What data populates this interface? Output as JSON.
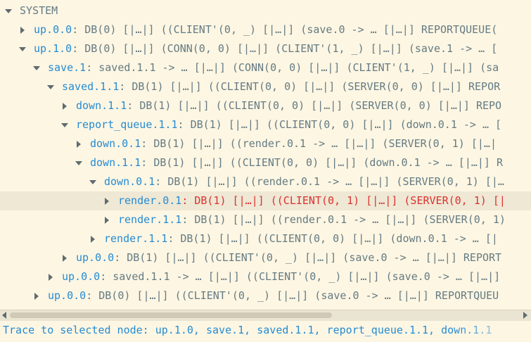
{
  "tree": {
    "rows": [
      {
        "name": "SYSTEM",
        "text": "",
        "indent": 0,
        "expanded": true,
        "selected": false
      },
      {
        "name": "up.0.0",
        "text": "DB(0) [|…|] ((CLIENT'(0, _) [|…|] (save.0 -> … [|…|] REPORTQUEUE(",
        "indent": 1,
        "expanded": false,
        "selected": false
      },
      {
        "name": "up.1.0",
        "text": "DB(0) [|…|] (CONN(0, 0) [|…|] (CLIENT'(1, _) [|…|] (save.1 -> … [",
        "indent": 1,
        "expanded": true,
        "selected": false
      },
      {
        "name": "save.1",
        "text": "saved.1.1 -> … [|…|] (CONN(0, 0) [|…|] (CLIENT'(1, _) [|…|] (sa",
        "indent": 2,
        "expanded": true,
        "selected": false
      },
      {
        "name": "saved.1.1",
        "text": "DB(1) [|…|] ((CLIENT(0, 0) [|…|] (SERVER(0, 0) [|…|] REPOR",
        "indent": 3,
        "expanded": true,
        "selected": false
      },
      {
        "name": "down.1.1",
        "text": "DB(1) [|…|] ((CLIENT(0, 0) [|…|] (SERVER(0, 0) [|…|] REPO",
        "indent": 4,
        "expanded": false,
        "selected": false
      },
      {
        "name": "report_queue.1.1",
        "text": "DB(1) [|…|] ((CLIENT(0, 0) [|…|] (down.0.1 -> … [",
        "indent": 4,
        "expanded": true,
        "selected": false
      },
      {
        "name": "down.0.1",
        "text": "DB(1) [|…|] ((render.0.1 -> … [|…|] (SERVER(0, 1) [|…|",
        "indent": 5,
        "expanded": false,
        "selected": false
      },
      {
        "name": "down.1.1",
        "text": "DB(1) [|…|] ((CLIENT(0, 0) [|…|] (down.0.1 -> … [|…|] R",
        "indent": 5,
        "expanded": true,
        "selected": false
      },
      {
        "name": "down.0.1",
        "text": "DB(1) [|…|] ((render.0.1 -> … [|…|] (SERVER(0, 1) [|…",
        "indent": 6,
        "expanded": true,
        "selected": false
      },
      {
        "name": "render.0.1",
        "text": "DB(1) [|…|] ((CLIENT(0, 1) [|…|] (SERVER(0, 1) [|",
        "indent": 7,
        "expanded": false,
        "selected": true
      },
      {
        "name": "render.1.1",
        "text": "DB(1) [|…|] ((render.0.1 -> … [|…|] (SERVER(0, 1)",
        "indent": 7,
        "expanded": false,
        "selected": false
      },
      {
        "name": "render.1.1",
        "text": "DB(1) [|…|] ((CLIENT(0, 0) [|…|] (down.0.1 -> … [|",
        "indent": 6,
        "expanded": false,
        "selected": false
      },
      {
        "name": "up.0.0",
        "text": "DB(1) [|…|] ((CLIENT'(0, _) [|…|] (save.0 -> … [|…|] REPORT",
        "indent": 4,
        "expanded": false,
        "selected": false
      },
      {
        "name": "up.0.0",
        "text": "saved.1.1 -> … [|…|] ((CLIENT'(0, _) [|…|] (save.0 -> … [|…|]",
        "indent": 3,
        "expanded": false,
        "selected": false
      },
      {
        "name": "up.0.0",
        "text": "DB(0) [|…|] ((CLIENT'(0, _) [|…|] (save.0 -> … [|…|] REPORTQUEU",
        "indent": 2,
        "expanded": false,
        "selected": false
      }
    ]
  },
  "status": {
    "text": "Trace to selected node: up.1.0, save.1, saved.1.1, report_queue.1.1, down.1.1"
  },
  "colors": {
    "background": "#fdf6e3",
    "node_name": "#268bd2",
    "node_text": "#657b83",
    "selected_text": "#dc322f",
    "selected_row": "#eee8d5"
  }
}
